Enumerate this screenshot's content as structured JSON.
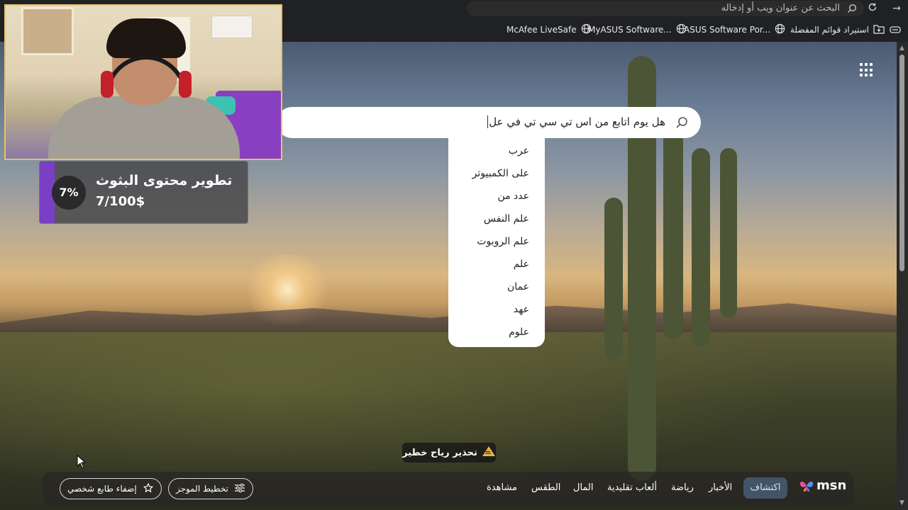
{
  "browser": {
    "address_placeholder": "البحث عن عنوان ويب أو إدخاله",
    "bookmarks": [
      {
        "label": "استيراد قوائم المفضلة",
        "icon": "folder-import-icon"
      },
      {
        "label": "ASUS Software Por...",
        "icon": "globe-icon"
      },
      {
        "label": "MyASUS Software...",
        "icon": "globe-icon"
      },
      {
        "label": "McAfee LiveSafe",
        "icon": "globe-icon"
      }
    ]
  },
  "search": {
    "value": "هل يوم اتابع من اس تي سي تي في عل",
    "suggestions": [
      "عرب",
      "على الكمبيوتر",
      "عدد من",
      "علم النفس",
      "علم الروبوت",
      "علم",
      "عمان",
      "عهد",
      "علوم"
    ]
  },
  "weather_alert": {
    "label": "تحذير رياح خطير",
    "icon": "wind-warning-icon"
  },
  "bottom_nav": {
    "brand": "msn",
    "active": "اكتشاف",
    "items": [
      "الأخبار",
      "رياضة",
      "ألعاب تقليدية",
      "المال",
      "الطقس",
      "مشاهدة"
    ],
    "layout_button": "تخطيط الموجز",
    "personalize_button": "إضفاء طابع شخصي"
  },
  "stream_goal": {
    "title": "تطوير محتوى البثوث",
    "amount": "7/100$",
    "percent_label": "7%",
    "progress": 0.07
  },
  "colors": {
    "goal_fill": "#7a3fc4",
    "webcam_border": "#e4c36a",
    "nav_active": "#5a78a0"
  }
}
